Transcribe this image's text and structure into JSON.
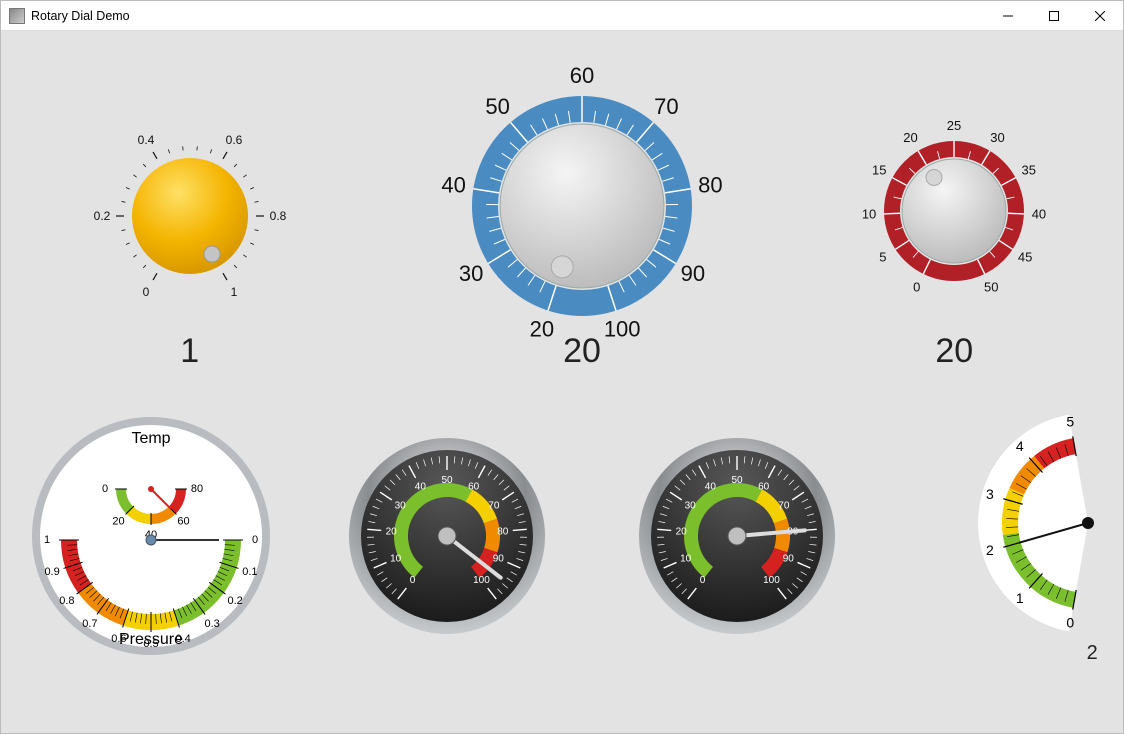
{
  "window": {
    "title": "Rotary Dial Demo"
  },
  "dials": {
    "yellow": {
      "min": 0,
      "max": 1,
      "value": 1,
      "ticks": [
        "0",
        "0.2",
        "0.4",
        "0.6",
        "0.8",
        "1"
      ],
      "color": "#f4b400"
    },
    "blue": {
      "min": 20,
      "max": 100,
      "value": 20,
      "ticks": [
        "20",
        "30",
        "40",
        "50",
        "60",
        "70",
        "80",
        "90",
        "100"
      ],
      "ring": "#4a8cc2"
    },
    "red": {
      "min": 0,
      "max": 50,
      "value": 20,
      "ticks": [
        "0",
        "5",
        "10",
        "15",
        "20",
        "25",
        "30",
        "35",
        "40",
        "45",
        "50"
      ],
      "ring": "#b12026"
    }
  },
  "display_values": {
    "yellow": "1",
    "blue": "20",
    "red": "20"
  },
  "gauges": {
    "combo": {
      "temp": {
        "title": "Temp",
        "ticks": [
          "0",
          "20",
          "40",
          "60",
          "80"
        ],
        "value": 60
      },
      "pressure": {
        "title": "Pressure",
        "ticks": [
          "0",
          "0.1",
          "0.2",
          "0.3",
          "0.4",
          "0.5",
          "0.6",
          "0.7",
          "0.8",
          "0.9",
          "1"
        ],
        "value": 0
      }
    },
    "speedo1": {
      "ticks": [
        "0",
        "10",
        "20",
        "30",
        "40",
        "50",
        "60",
        "70",
        "80",
        "90",
        "100"
      ],
      "value": 95
    },
    "speedo2": {
      "ticks": [
        "0",
        "10",
        "20",
        "30",
        "40",
        "50",
        "60",
        "70",
        "80",
        "90",
        "100"
      ],
      "value": 80
    },
    "fan": {
      "ticks": [
        "0",
        "1",
        "2",
        "3",
        "4",
        "5"
      ],
      "value": 2
    }
  },
  "display_values_bottom": {
    "fan": "2"
  },
  "colors": {
    "green": "#7bbf2c",
    "yellow": "#f4d000",
    "orange": "#f08a00",
    "red": "#d62121",
    "dark": "#2a2a2a",
    "steel": "#cfd3d6"
  }
}
